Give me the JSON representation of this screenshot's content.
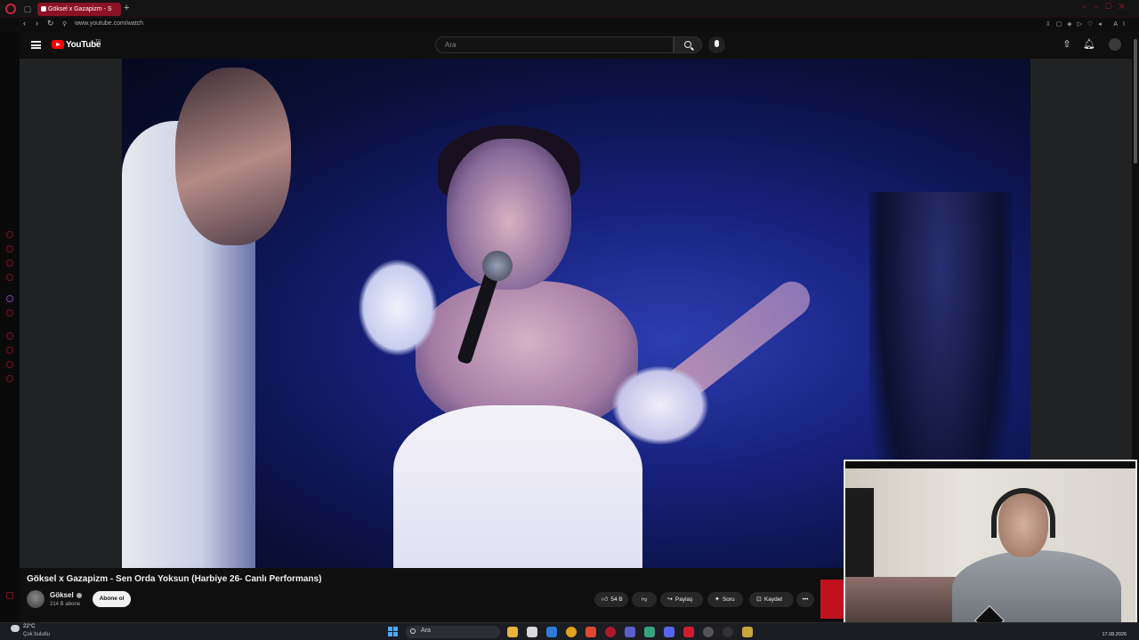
{
  "browser": {
    "tab_title": "Göksel x Gazapizm - S",
    "url": "www.youtube.com/watch",
    "ai_label": "AI"
  },
  "youtube": {
    "wordmark": "YouTube",
    "country_code": "TR",
    "search_placeholder": "Ara"
  },
  "video": {
    "title": "Göksel x Gazapizm - Sen Orda Yoksun (Harbiye 26- Canlı Performans)",
    "channel_name": "Göksel",
    "subscribers": "214 B abone",
    "subscribe_label": "Abone ol",
    "like_count": "54 B",
    "share_label": "Paylaş",
    "ask_label": "Soru",
    "save_label": "Kaydet",
    "more_label": "•••"
  },
  "taskbar": {
    "temperature": "22°C",
    "weather": "Çok bulutlu",
    "search_placeholder": "Ara",
    "date": "17.08.2026"
  },
  "colors": {
    "accent": "#ff0000",
    "browser_accent": "#8b1224",
    "background": "#0f0f0f"
  }
}
